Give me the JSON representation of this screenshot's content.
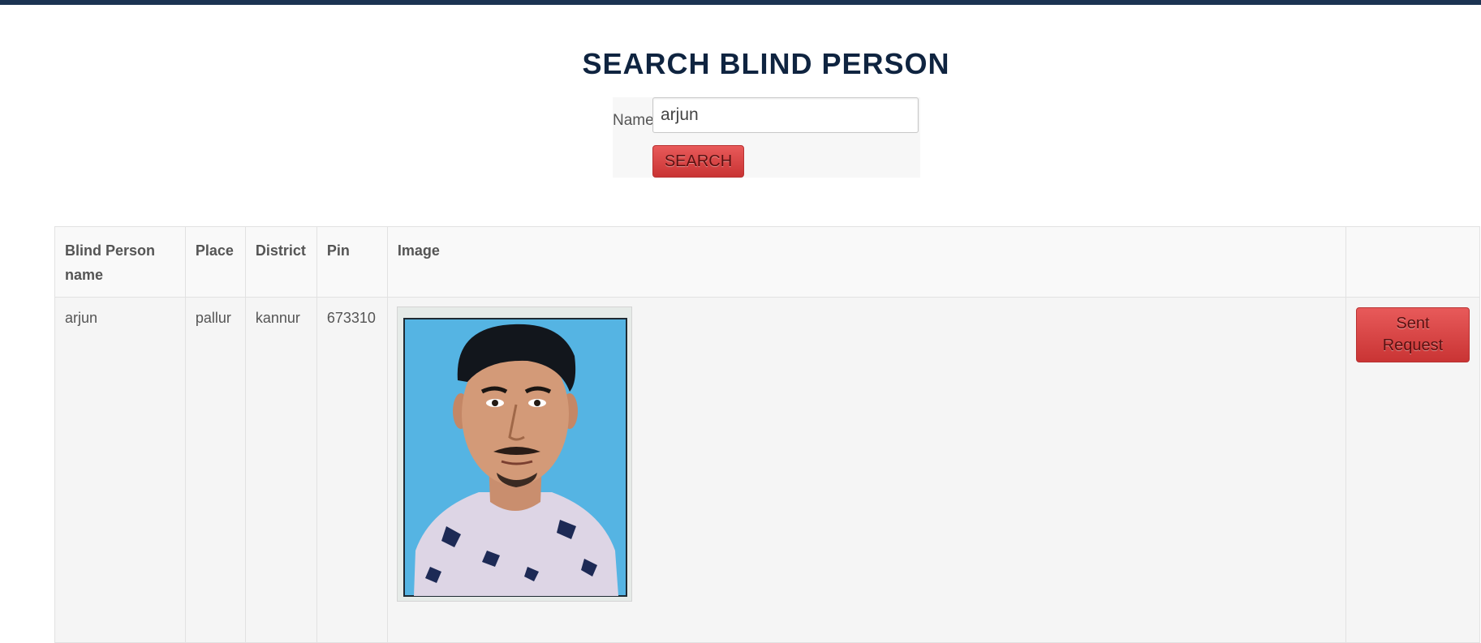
{
  "page": {
    "title": "SEARCH BLIND PERSON"
  },
  "search": {
    "label": "Name",
    "value": "arjun",
    "button_label": "SEARCH"
  },
  "table": {
    "headers": [
      "Blind Person name",
      "Place",
      "District",
      "Pin",
      "Image",
      ""
    ],
    "rows": [
      {
        "name": "arjun",
        "place": "pallur",
        "district": "kannur",
        "pin": "673310",
        "image": "passport-photo",
        "action_label": "Sent Request"
      }
    ]
  },
  "colors": {
    "top_bar": "#1b3352",
    "title": "#0f2440",
    "button": "#d94545",
    "photo_background": "#55b4e3"
  }
}
